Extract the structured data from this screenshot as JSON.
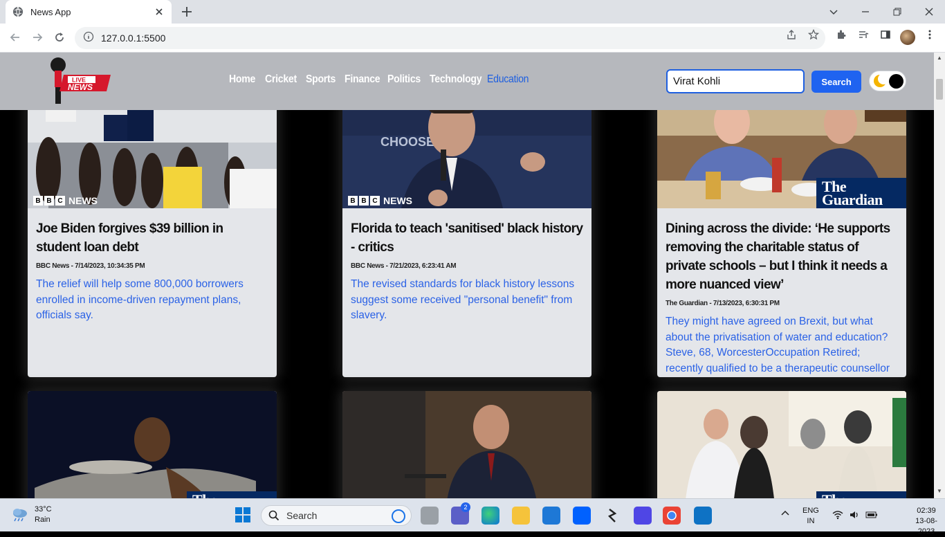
{
  "browser": {
    "tab_title": "News App",
    "url": "127.0.0.1:5500"
  },
  "app": {
    "logo_text_top": "LIVE",
    "logo_text_bottom": "NEWS",
    "nav": [
      {
        "label": "Home",
        "active": false
      },
      {
        "label": "Cricket",
        "active": false
      },
      {
        "label": "Sports",
        "active": false
      },
      {
        "label": "Finance",
        "active": false
      },
      {
        "label": "Politics",
        "active": false
      },
      {
        "label": "Technology",
        "active": false
      },
      {
        "label": "Education",
        "active": true
      }
    ],
    "search_value": "Virat Kohli",
    "search_button": "Search"
  },
  "cards": [
    {
      "source_badge": "BBC NEWS",
      "title": "Joe Biden forgives $39 billion in student loan debt",
      "meta": "BBC News - 7/14/2023, 10:34:35 PM",
      "description": "The relief will help some 800,000 borrowers enrolled in income-driven repayment plans, officials say."
    },
    {
      "source_badge": "BBC NEWS",
      "title": "Florida to teach 'sanitised' black history - critics",
      "meta": "BBC News - 7/21/2023, 6:23:41 AM",
      "description": "The revised standards for black history lessons suggest some received \"personal benefit\" from slavery."
    },
    {
      "source_badge": "The Guardian",
      "title": "Dining across the divide: ‘He supports removing the charitable status of private schools – but I think it needs a more nuanced view’",
      "meta": "The Guardian - 7/13/2023, 6:30:31 PM",
      "description": "They might have agreed on Brexit, but what about the privatisation of water and education? Steve, 68, WorcesterOccupation Retired; recently qualified to be a therapeutic counsellor"
    },
    {
      "source_badge": "The..."
    },
    {
      "source_badge": ""
    },
    {
      "source_badge": "The..."
    }
  ],
  "taskbar": {
    "weather_temp": "33°C",
    "weather_cond": "Rain",
    "search_placeholder": "Search",
    "lang_top": "ENG",
    "lang_bottom": "IN",
    "time": "02:39",
    "date": "13-08-2023",
    "teams_badge": "2"
  }
}
